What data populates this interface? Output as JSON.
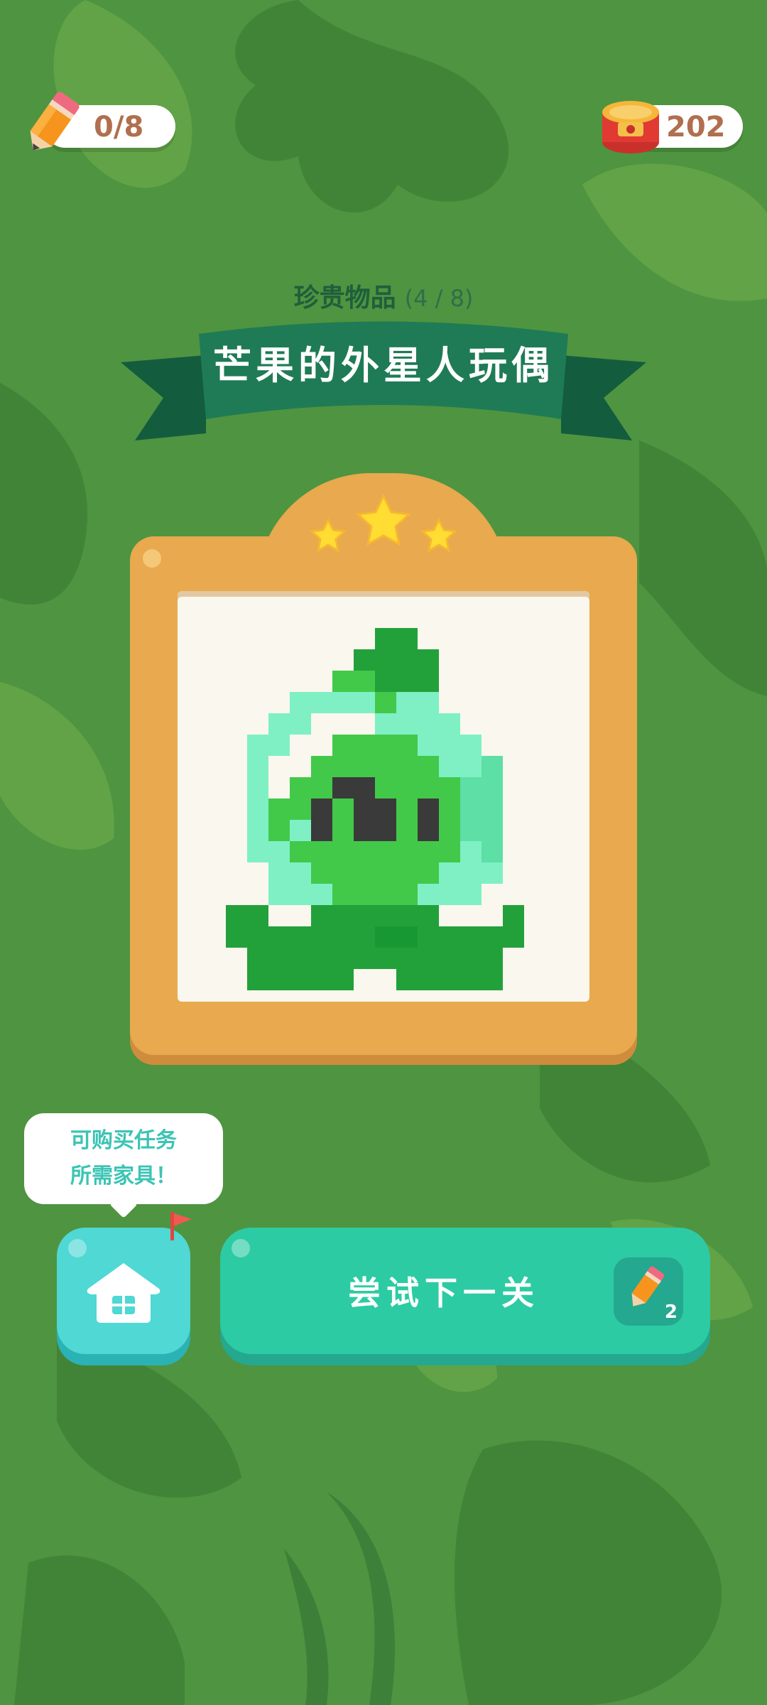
{
  "hud": {
    "pencils": "0/8",
    "coins": "202",
    "pencil_icon": "pencil-icon",
    "coin_icon": "coin-jar-icon"
  },
  "collection": {
    "subtitle": "珍贵物品",
    "count": "(4 / 8)",
    "title": "芒果的外星人玩偶",
    "stars_earned": 3,
    "stars_total": 3
  },
  "tip": {
    "line1": "可购买任务",
    "line2": "所需家具！"
  },
  "actions": {
    "home_icon": "house-icon",
    "next_label": "尝试下一关",
    "next_cost": "2"
  },
  "pixel_art": {
    "colors": {
      "a": "#22a13a",
      "b": "#179833",
      "c": "#42c94a",
      "d": "#7ef0c4",
      "e": "#5ddfa6",
      "f": "#3a3a3a",
      "w": "#faf7ee"
    },
    "grid": [
      "...............",
      "........aa.....",
      ".......aaaa....",
      "......ccaaa....",
      "....ddddcdd....",
      "...ddwwwdddd...",
      "..ddwwccccddd..",
      "..dwwccccccdde.",
      "..dwccffccccee.",
      "..dccfcffcfcee.",
      "..dcdfcffcfcee.",
      "..ddccccccccde.",
      "...ddccccccddd.",
      "...dddccccddd..",
      ".aa..aaaaaa...a",
      ".aaaaaaabbaaaaa",
      "..aaaaaaaaaaaa.",
      "..aaaaa..aaaaa.",
      "..............."
    ]
  }
}
